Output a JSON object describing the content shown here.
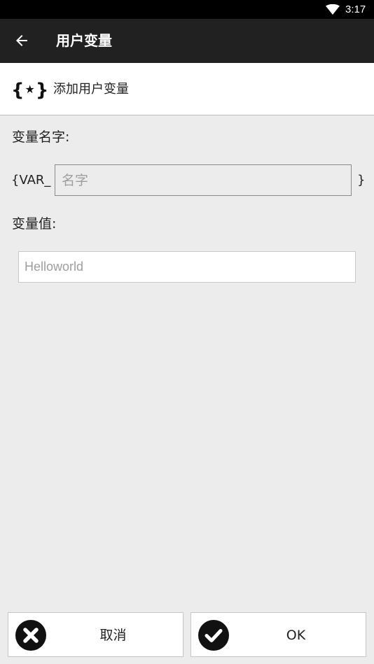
{
  "status_bar": {
    "time": "3:17",
    "wifi_icon": "wifi-icon"
  },
  "app_bar": {
    "title": "用户变量",
    "back_icon": "arrow-back-icon"
  },
  "header": {
    "label": "添加用户变量",
    "icon": "variable-brace-star-icon"
  },
  "form": {
    "name_label": "变量名字:",
    "name_prefix": "{VAR_",
    "name_suffix": "}",
    "name_placeholder": "名字",
    "name_value": "",
    "value_label": "变量值:",
    "value_placeholder": "Helloworld",
    "value_value": ""
  },
  "buttons": {
    "cancel_label": "取消",
    "cancel_icon": "close-circle-icon",
    "ok_label": "OK",
    "ok_icon": "check-circle-icon"
  },
  "colors": {
    "status_bar": "#000000",
    "app_bar": "#212121",
    "background": "#ececec",
    "surface": "#ffffff"
  }
}
